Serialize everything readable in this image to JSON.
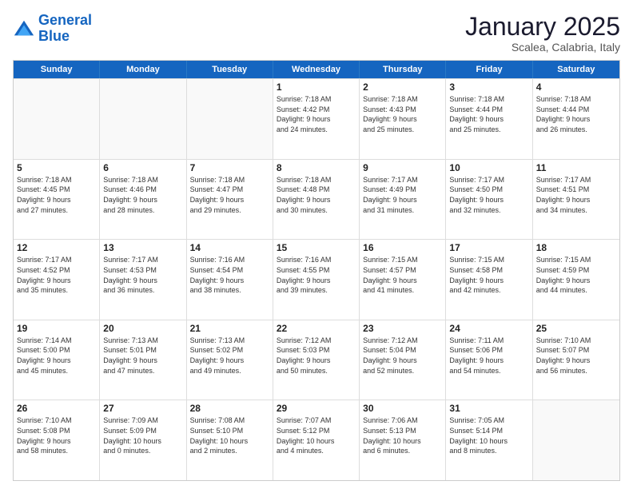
{
  "header": {
    "logo_general": "General",
    "logo_blue": "Blue",
    "month_title": "January 2025",
    "subtitle": "Scalea, Calabria, Italy"
  },
  "weekdays": [
    "Sunday",
    "Monday",
    "Tuesday",
    "Wednesday",
    "Thursday",
    "Friday",
    "Saturday"
  ],
  "weeks": [
    [
      {
        "day": "",
        "info": ""
      },
      {
        "day": "",
        "info": ""
      },
      {
        "day": "",
        "info": ""
      },
      {
        "day": "1",
        "info": "Sunrise: 7:18 AM\nSunset: 4:42 PM\nDaylight: 9 hours\nand 24 minutes."
      },
      {
        "day": "2",
        "info": "Sunrise: 7:18 AM\nSunset: 4:43 PM\nDaylight: 9 hours\nand 25 minutes."
      },
      {
        "day": "3",
        "info": "Sunrise: 7:18 AM\nSunset: 4:44 PM\nDaylight: 9 hours\nand 25 minutes."
      },
      {
        "day": "4",
        "info": "Sunrise: 7:18 AM\nSunset: 4:44 PM\nDaylight: 9 hours\nand 26 minutes."
      }
    ],
    [
      {
        "day": "5",
        "info": "Sunrise: 7:18 AM\nSunset: 4:45 PM\nDaylight: 9 hours\nand 27 minutes."
      },
      {
        "day": "6",
        "info": "Sunrise: 7:18 AM\nSunset: 4:46 PM\nDaylight: 9 hours\nand 28 minutes."
      },
      {
        "day": "7",
        "info": "Sunrise: 7:18 AM\nSunset: 4:47 PM\nDaylight: 9 hours\nand 29 minutes."
      },
      {
        "day": "8",
        "info": "Sunrise: 7:18 AM\nSunset: 4:48 PM\nDaylight: 9 hours\nand 30 minutes."
      },
      {
        "day": "9",
        "info": "Sunrise: 7:17 AM\nSunset: 4:49 PM\nDaylight: 9 hours\nand 31 minutes."
      },
      {
        "day": "10",
        "info": "Sunrise: 7:17 AM\nSunset: 4:50 PM\nDaylight: 9 hours\nand 32 minutes."
      },
      {
        "day": "11",
        "info": "Sunrise: 7:17 AM\nSunset: 4:51 PM\nDaylight: 9 hours\nand 34 minutes."
      }
    ],
    [
      {
        "day": "12",
        "info": "Sunrise: 7:17 AM\nSunset: 4:52 PM\nDaylight: 9 hours\nand 35 minutes."
      },
      {
        "day": "13",
        "info": "Sunrise: 7:17 AM\nSunset: 4:53 PM\nDaylight: 9 hours\nand 36 minutes."
      },
      {
        "day": "14",
        "info": "Sunrise: 7:16 AM\nSunset: 4:54 PM\nDaylight: 9 hours\nand 38 minutes."
      },
      {
        "day": "15",
        "info": "Sunrise: 7:16 AM\nSunset: 4:55 PM\nDaylight: 9 hours\nand 39 minutes."
      },
      {
        "day": "16",
        "info": "Sunrise: 7:15 AM\nSunset: 4:57 PM\nDaylight: 9 hours\nand 41 minutes."
      },
      {
        "day": "17",
        "info": "Sunrise: 7:15 AM\nSunset: 4:58 PM\nDaylight: 9 hours\nand 42 minutes."
      },
      {
        "day": "18",
        "info": "Sunrise: 7:15 AM\nSunset: 4:59 PM\nDaylight: 9 hours\nand 44 minutes."
      }
    ],
    [
      {
        "day": "19",
        "info": "Sunrise: 7:14 AM\nSunset: 5:00 PM\nDaylight: 9 hours\nand 45 minutes."
      },
      {
        "day": "20",
        "info": "Sunrise: 7:13 AM\nSunset: 5:01 PM\nDaylight: 9 hours\nand 47 minutes."
      },
      {
        "day": "21",
        "info": "Sunrise: 7:13 AM\nSunset: 5:02 PM\nDaylight: 9 hours\nand 49 minutes."
      },
      {
        "day": "22",
        "info": "Sunrise: 7:12 AM\nSunset: 5:03 PM\nDaylight: 9 hours\nand 50 minutes."
      },
      {
        "day": "23",
        "info": "Sunrise: 7:12 AM\nSunset: 5:04 PM\nDaylight: 9 hours\nand 52 minutes."
      },
      {
        "day": "24",
        "info": "Sunrise: 7:11 AM\nSunset: 5:06 PM\nDaylight: 9 hours\nand 54 minutes."
      },
      {
        "day": "25",
        "info": "Sunrise: 7:10 AM\nSunset: 5:07 PM\nDaylight: 9 hours\nand 56 minutes."
      }
    ],
    [
      {
        "day": "26",
        "info": "Sunrise: 7:10 AM\nSunset: 5:08 PM\nDaylight: 9 hours\nand 58 minutes."
      },
      {
        "day": "27",
        "info": "Sunrise: 7:09 AM\nSunset: 5:09 PM\nDaylight: 10 hours\nand 0 minutes."
      },
      {
        "day": "28",
        "info": "Sunrise: 7:08 AM\nSunset: 5:10 PM\nDaylight: 10 hours\nand 2 minutes."
      },
      {
        "day": "29",
        "info": "Sunrise: 7:07 AM\nSunset: 5:12 PM\nDaylight: 10 hours\nand 4 minutes."
      },
      {
        "day": "30",
        "info": "Sunrise: 7:06 AM\nSunset: 5:13 PM\nDaylight: 10 hours\nand 6 minutes."
      },
      {
        "day": "31",
        "info": "Sunrise: 7:05 AM\nSunset: 5:14 PM\nDaylight: 10 hours\nand 8 minutes."
      },
      {
        "day": "",
        "info": ""
      }
    ]
  ]
}
